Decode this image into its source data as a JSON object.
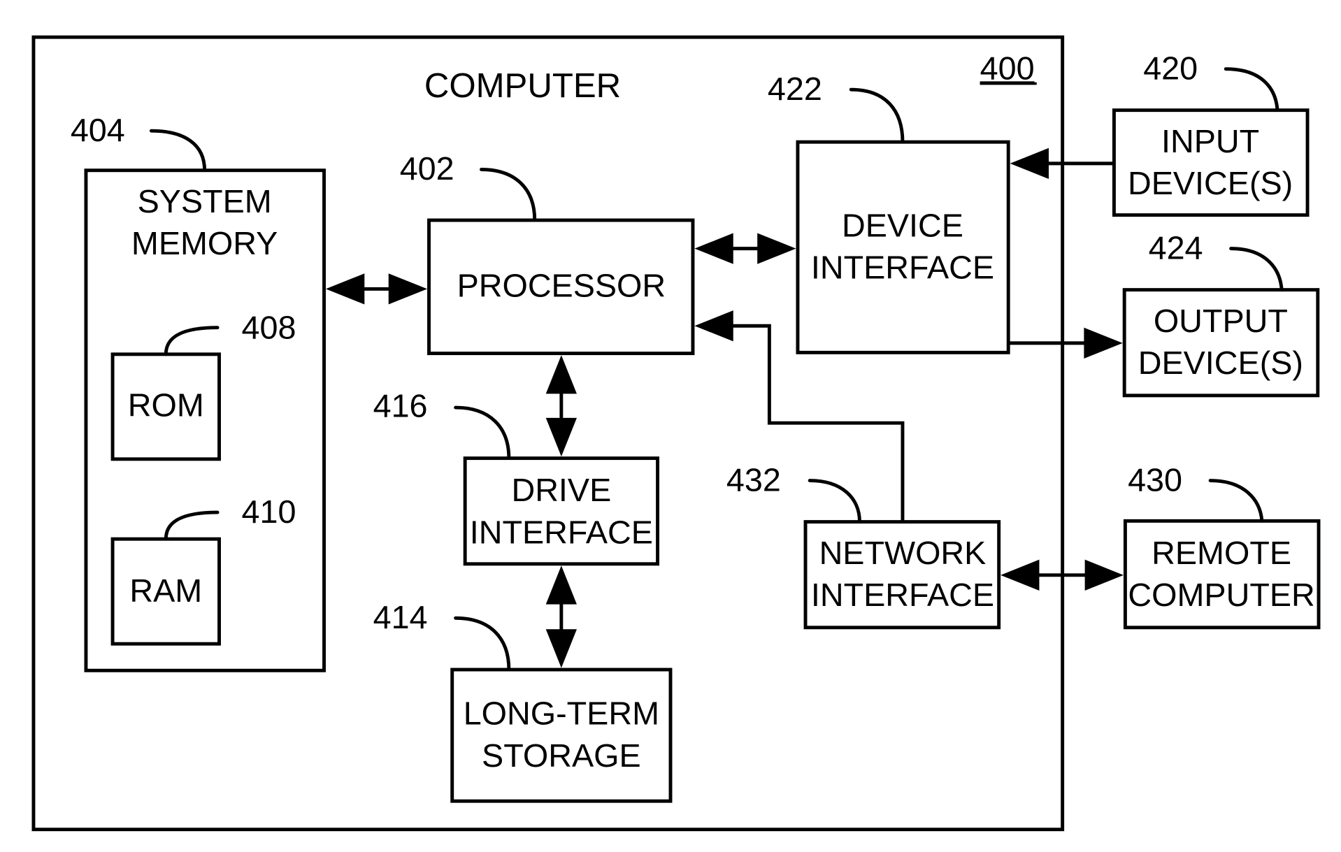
{
  "diagram": {
    "title": "COMPUTER",
    "figure_ref": "400",
    "blocks": {
      "system_memory": {
        "ref": "404",
        "lines": [
          "SYSTEM",
          "MEMORY"
        ]
      },
      "rom": {
        "ref": "408",
        "lines": [
          "ROM"
        ]
      },
      "ram": {
        "ref": "410",
        "lines": [
          "RAM"
        ]
      },
      "processor": {
        "ref": "402",
        "lines": [
          "PROCESSOR"
        ]
      },
      "device_interface": {
        "ref": "422",
        "lines": [
          "DEVICE",
          "INTERFACE"
        ]
      },
      "drive_interface": {
        "ref": "416",
        "lines": [
          "DRIVE",
          "INTERFACE"
        ]
      },
      "long_term_storage": {
        "ref": "414",
        "lines": [
          "LONG-TERM",
          "STORAGE"
        ]
      },
      "network_interface": {
        "ref": "432",
        "lines": [
          "NETWORK",
          "INTERFACE"
        ]
      },
      "input_devices": {
        "ref": "420",
        "lines": [
          "INPUT",
          "DEVICE(S)"
        ]
      },
      "output_devices": {
        "ref": "424",
        "lines": [
          "OUTPUT",
          "DEVICE(S)"
        ]
      },
      "remote_computer": {
        "ref": "430",
        "lines": [
          "REMOTE",
          "COMPUTER"
        ]
      }
    },
    "connections": [
      {
        "from": "system_memory",
        "to": "processor",
        "direction": "bidirectional"
      },
      {
        "from": "processor",
        "to": "device_interface",
        "direction": "bidirectional"
      },
      {
        "from": "processor",
        "to": "drive_interface",
        "direction": "bidirectional"
      },
      {
        "from": "drive_interface",
        "to": "long_term_storage",
        "direction": "bidirectional"
      },
      {
        "from": "network_interface",
        "to": "processor",
        "direction": "to"
      },
      {
        "from": "input_devices",
        "to": "device_interface",
        "direction": "to"
      },
      {
        "from": "device_interface",
        "to": "output_devices",
        "direction": "to"
      },
      {
        "from": "network_interface",
        "to": "remote_computer",
        "direction": "bidirectional"
      }
    ]
  }
}
